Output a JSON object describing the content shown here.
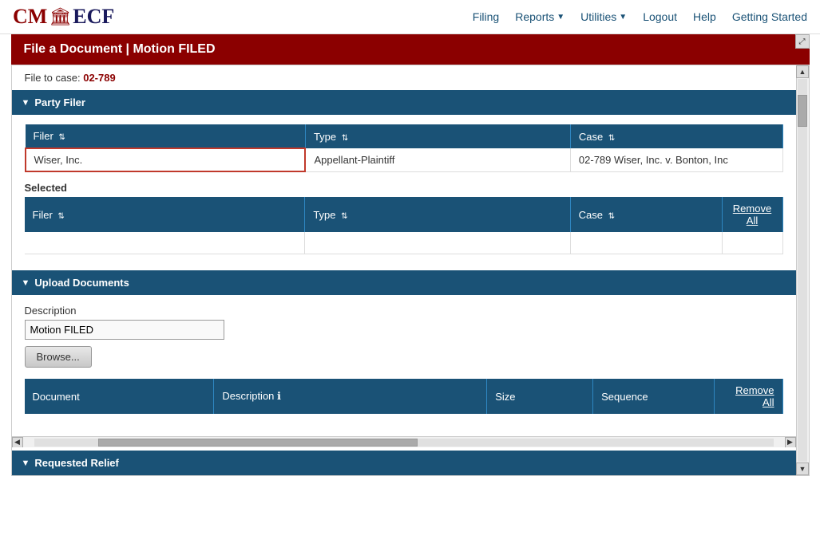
{
  "nav": {
    "logo_cm": "CM",
    "logo_ecf": "ECF",
    "filing_label": "Filing",
    "reports_label": "Reports",
    "utilities_label": "Utilities",
    "logout_label": "Logout",
    "help_label": "Help",
    "getting_started_label": "Getting Started"
  },
  "title": "File a Document | Motion FILED",
  "file_to_case_label": "File to case:",
  "case_number": "02-789",
  "party_filer": {
    "section_label": "Party Filer",
    "filer_col": "Filer",
    "type_col": "Type",
    "case_col": "Case",
    "filer_value": "Wiser, Inc.",
    "type_value": "Appellant-Plaintiff",
    "case_value": "02-789 Wiser, Inc. v. Bonton, Inc",
    "selected_label": "Selected",
    "selected_filer_col": "Filer",
    "selected_type_col": "Type",
    "selected_case_col": "Case",
    "remove_all_label": "Remove All"
  },
  "upload_documents": {
    "section_label": "Upload Documents",
    "description_label": "Description",
    "description_value": "Motion FILED",
    "browse_label": "Browse...",
    "doc_col": "Document",
    "desc_col": "Description",
    "size_col": "Size",
    "sequence_col": "Sequence",
    "remove_all_label": "Remove All",
    "info_icon": "ℹ"
  },
  "requested_relief": {
    "section_label": "Requested Relief"
  }
}
